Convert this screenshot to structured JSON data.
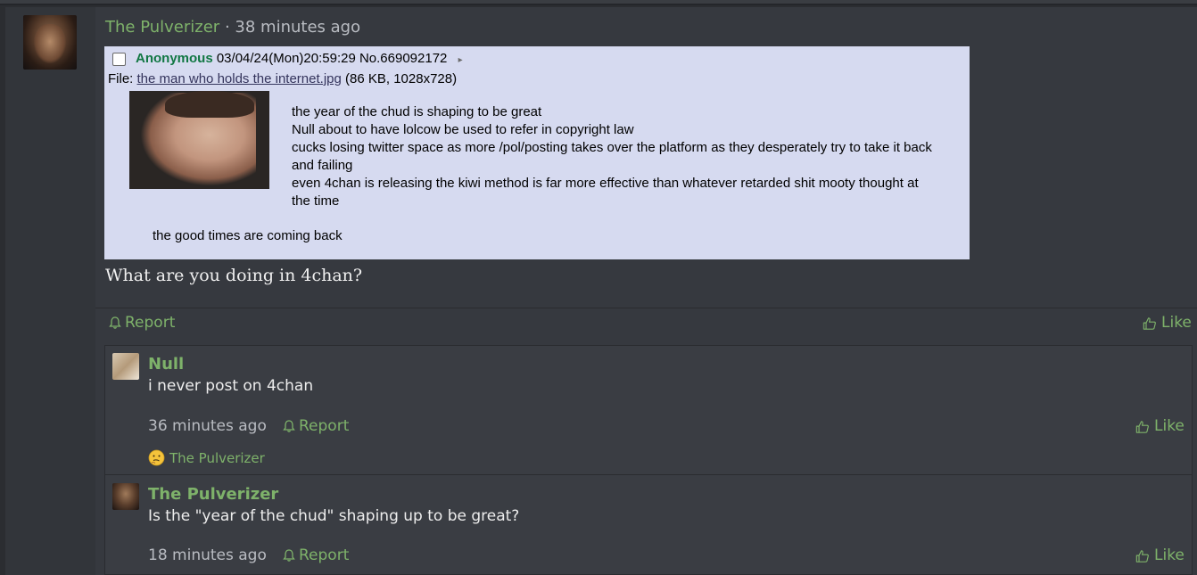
{
  "post": {
    "author": "The Pulverizer",
    "separator": "·",
    "time": "38 minutes ago",
    "text": "What are you doing in 4chan?",
    "report_label": "Report",
    "like_label": "Like"
  },
  "chan_post": {
    "name": "Anonymous",
    "datetime": "03/04/24(Mon)20:59:29",
    "post_no": "No.669092172",
    "arrow": "▸",
    "file_prefix": "File:",
    "file_name": "the man who holds the internet.jpg",
    "file_info": "(86 KB, 1028x728)",
    "lines": [
      "the year of the chud is shaping to be great",
      "Null about to have lolcow be used to refer in copyright law",
      "cucks losing twitter space as more /pol/posting takes over the platform as they desperately try to take it back and failing",
      "even 4chan is releasing the kiwi method is far more effective than whatever retarded shit mooty thought at the time"
    ],
    "footer": "the good times are coming back"
  },
  "replies": [
    {
      "author": "Null",
      "text": "i never post on 4chan",
      "time": "36 minutes ago",
      "report_label": "Report",
      "like_label": "Like",
      "reaction_user": "The Pulverizer"
    },
    {
      "author": "The Pulverizer",
      "text": "Is the \"year of the chud\" shaping up to be great?",
      "time": "18 minutes ago",
      "report_label": "Report",
      "like_label": "Like"
    }
  ],
  "colors": {
    "accent": "#7eb26a",
    "chan_bg": "#d6daf0",
    "chan_name": "#117743",
    "chan_link": "#34345c"
  }
}
